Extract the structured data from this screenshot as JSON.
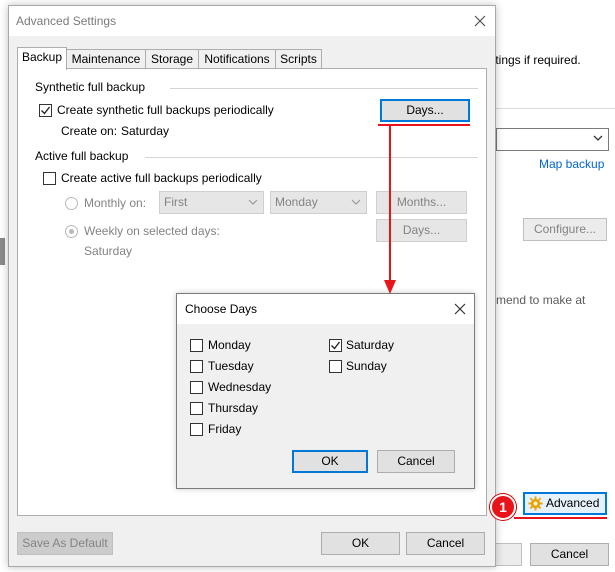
{
  "background_window": {
    "hint_text": "ttings if required.",
    "map_backup_link": "Map backup",
    "configure_button": "Configure...",
    "recommend_text": "mend to make at",
    "advanced_button": "Advanced",
    "cancel_button": "Cancel",
    "annotation_badge": "1"
  },
  "advanced_settings": {
    "title": "Advanced Settings",
    "tabs": [
      {
        "label": "Backup",
        "active": true
      },
      {
        "label": "Maintenance"
      },
      {
        "label": "Storage"
      },
      {
        "label": "Notifications"
      },
      {
        "label": "Scripts"
      }
    ],
    "synthetic": {
      "section_label": "Synthetic full backup",
      "checkbox_label": "Create synthetic full backups periodically",
      "checked": true,
      "create_on_label": "Create on:",
      "create_on_value": "Saturday",
      "days_button": "Days..."
    },
    "active": {
      "section_label": "Active full backup",
      "checkbox_label": "Create active full backups periodically",
      "checked": false,
      "monthly_label": "Monthly on:",
      "monthly_first": "First",
      "monthly_day": "Monday",
      "months_button": "Months...",
      "weekly_label": "Weekly on selected days:",
      "weekly_value": "Saturday",
      "days_button": "Days..."
    },
    "footer": {
      "save_default_button": "Save As Default",
      "ok_button": "OK",
      "cancel_button": "Cancel"
    }
  },
  "choose_days": {
    "title": "Choose Days",
    "days": [
      {
        "label": "Monday",
        "checked": false
      },
      {
        "label": "Tuesday",
        "checked": false
      },
      {
        "label": "Wednesday",
        "checked": false
      },
      {
        "label": "Thursday",
        "checked": false
      },
      {
        "label": "Friday",
        "checked": false
      },
      {
        "label": "Saturday",
        "checked": true
      },
      {
        "label": "Sunday",
        "checked": false
      }
    ],
    "ok_button": "OK",
    "cancel_button": "Cancel"
  },
  "colors": {
    "annotation_red": "#e8141a",
    "focus_blue": "#0078d7",
    "link_blue": "#0066cc"
  }
}
